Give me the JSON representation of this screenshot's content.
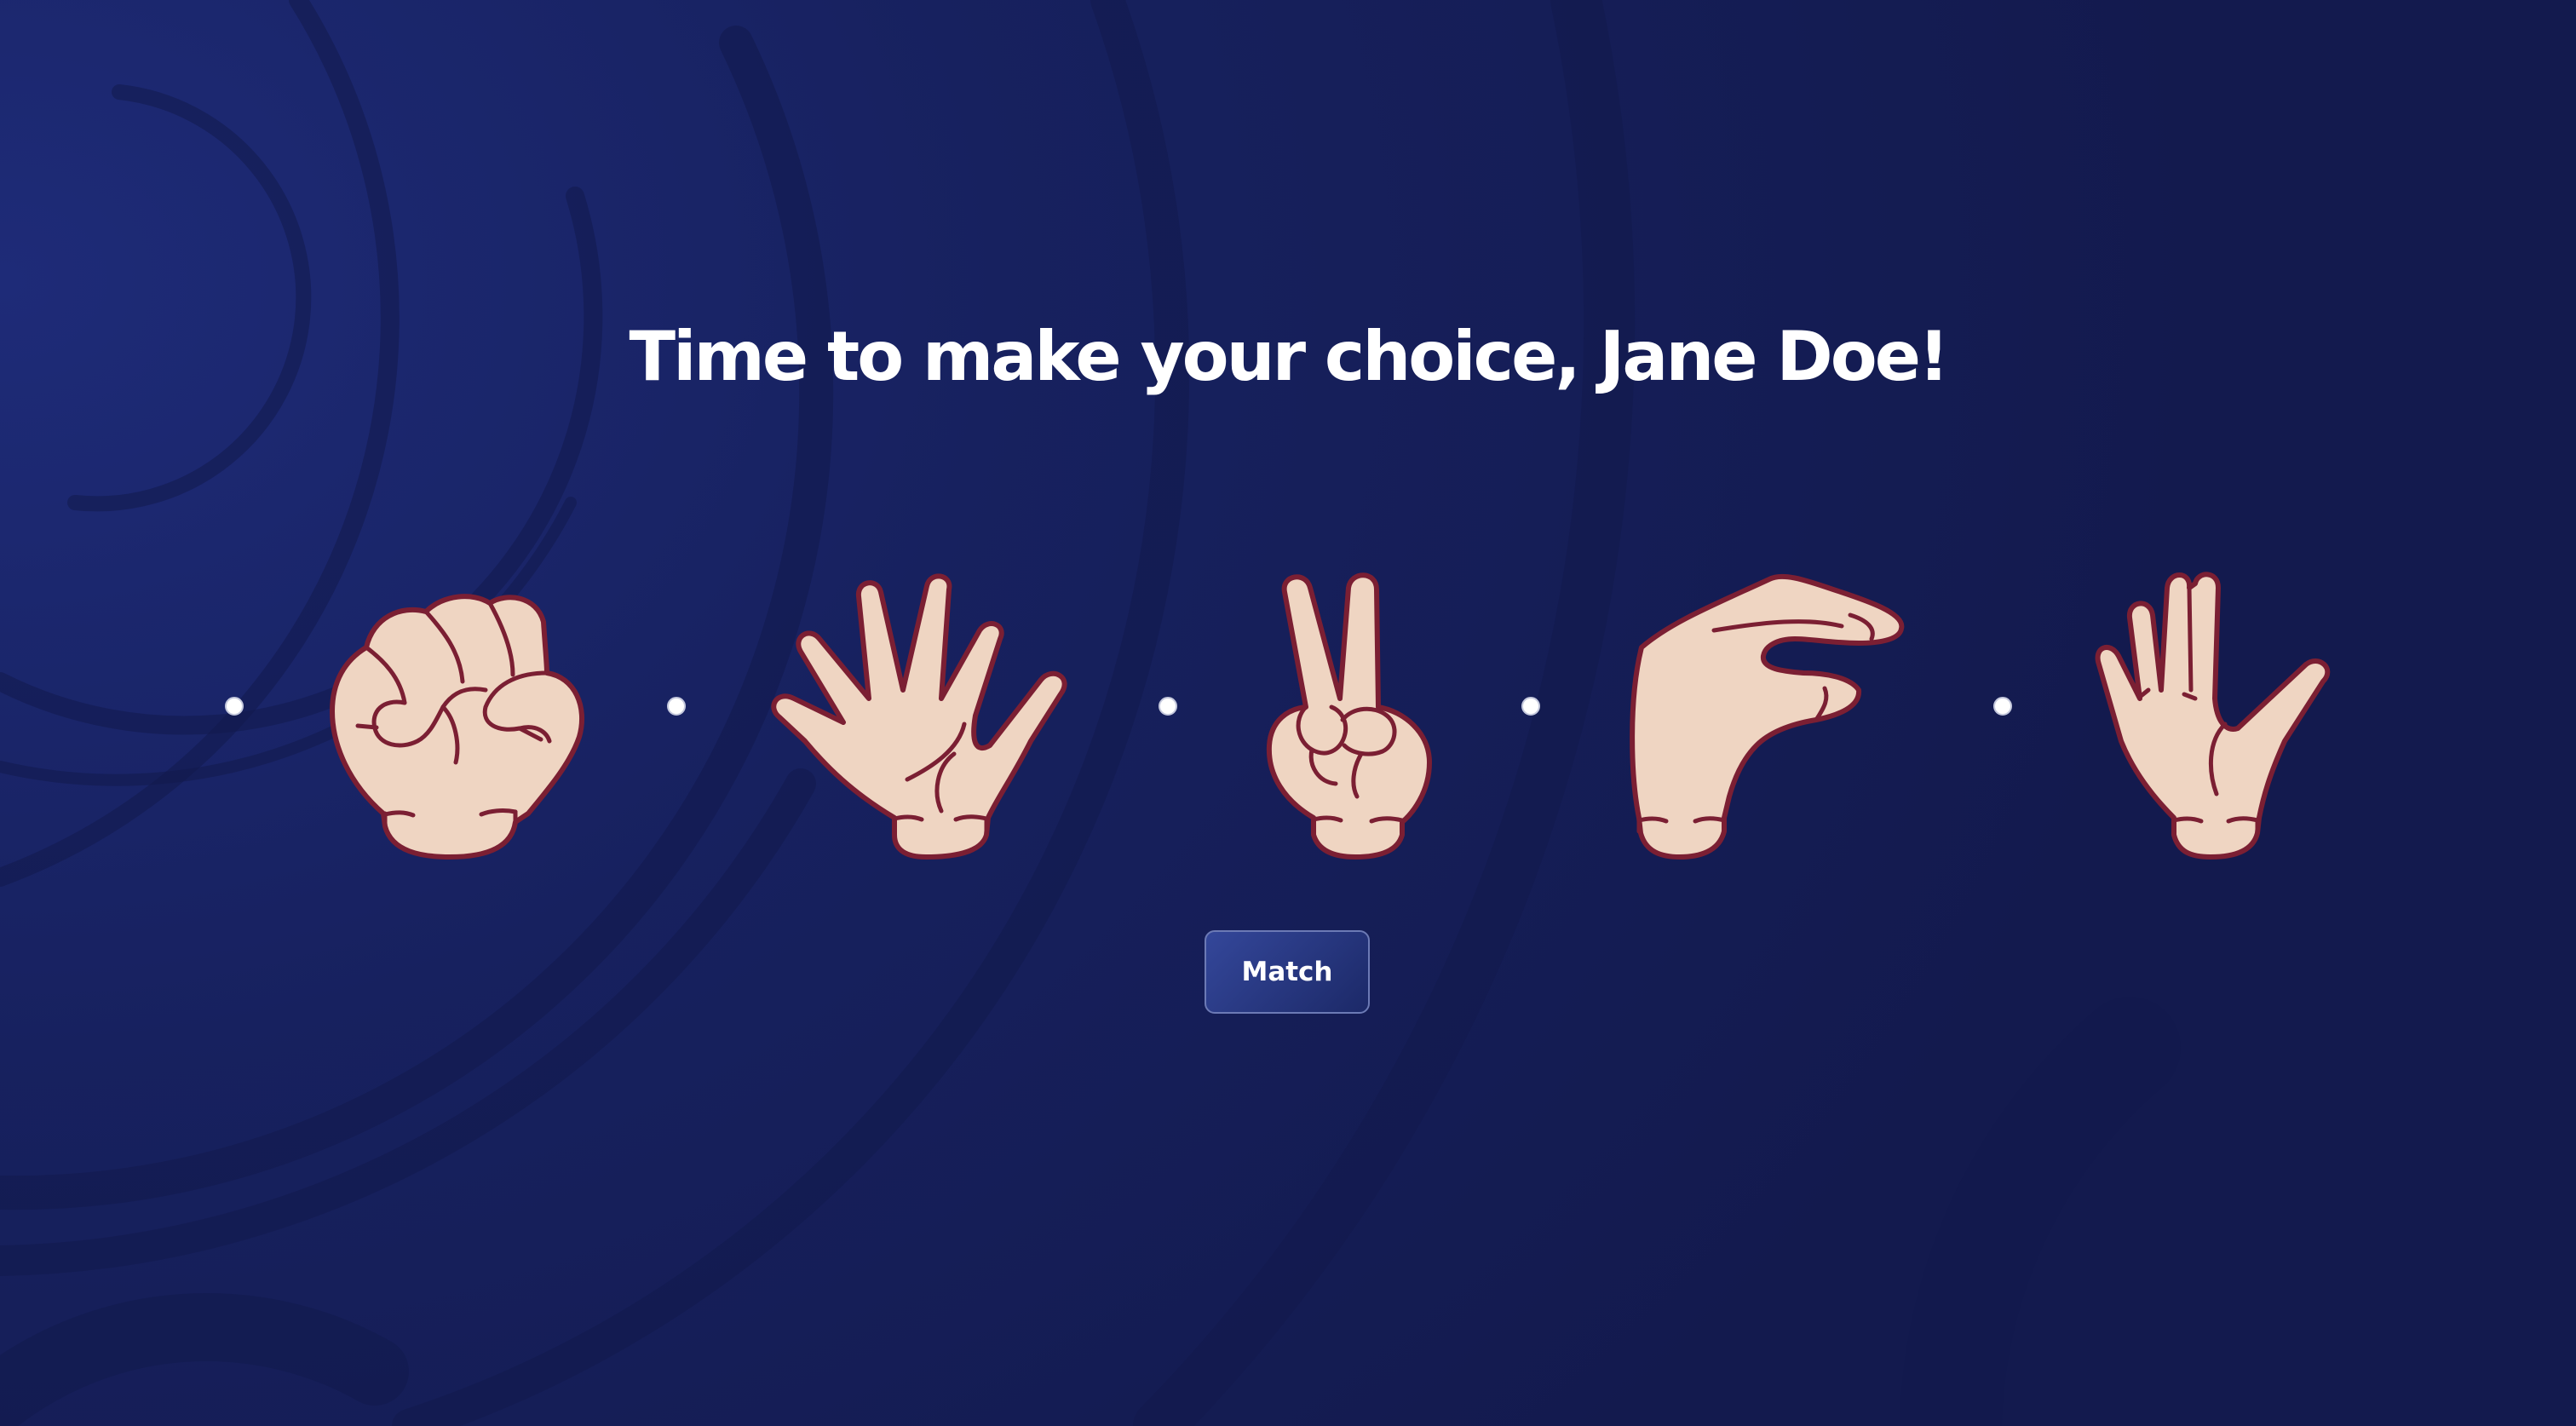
{
  "title": "Time to make your choice, Jane Doe!",
  "choices": [
    {
      "name": "rock",
      "icon": "fist-hand-icon"
    },
    {
      "name": "paper",
      "icon": "open-hand-icon"
    },
    {
      "name": "scissors",
      "icon": "victory-hand-icon"
    },
    {
      "name": "lizard",
      "icon": "pinching-hand-icon"
    },
    {
      "name": "spock",
      "icon": "vulcan-salute-icon"
    }
  ],
  "match_button_label": "Match",
  "colors": {
    "background": "#18225f",
    "skin": "#efd5c2",
    "outline": "#7b1f33",
    "button_border": "#6c7ab5",
    "text": "#ffffff"
  }
}
